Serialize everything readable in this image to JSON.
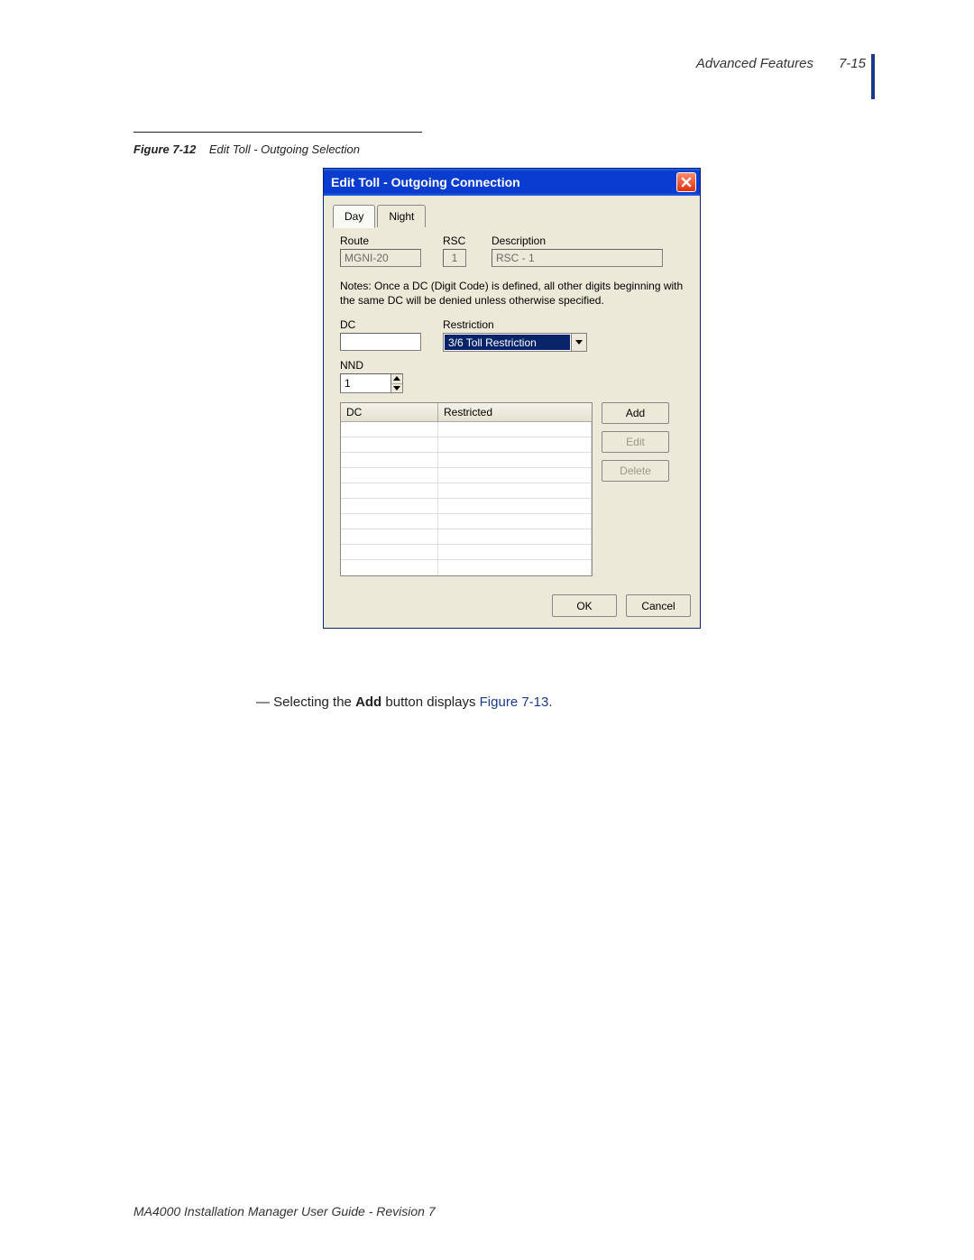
{
  "header": {
    "section": "Advanced Features",
    "page_number": "7-15"
  },
  "figure": {
    "label": "Figure 7-12",
    "caption": "Edit Toll - Outgoing Selection"
  },
  "dialog": {
    "title": "Edit Toll - Outgoing Connection",
    "tabs": {
      "day": "Day",
      "night": "Night"
    },
    "fields": {
      "route_label": "Route",
      "route_value": "MGNI-20",
      "rsc_label": "RSC",
      "rsc_value": "1",
      "description_label": "Description",
      "description_value": "RSC - 1",
      "notes": "Notes: Once a DC (Digit Code) is defined, all other digits beginning with the same DC will be denied unless otherwise specified.",
      "dc_label": "DC",
      "dc_value": "",
      "restriction_label": "Restriction",
      "restriction_value": "3/6 Toll Restriction",
      "nnd_label": "NND",
      "nnd_value": "1"
    },
    "table": {
      "col_dc": "DC",
      "col_restricted": "Restricted"
    },
    "buttons": {
      "add": "Add",
      "edit": "Edit",
      "delete": "Delete",
      "ok": "OK",
      "cancel": "Cancel"
    }
  },
  "body": {
    "prefix": "— Selecting the ",
    "bold": "Add",
    "mid": " button displays ",
    "link": "Figure 7-13",
    "suffix": "."
  },
  "footer": {
    "text": "MA4000 Installation Manager User Guide - Revision 7"
  }
}
